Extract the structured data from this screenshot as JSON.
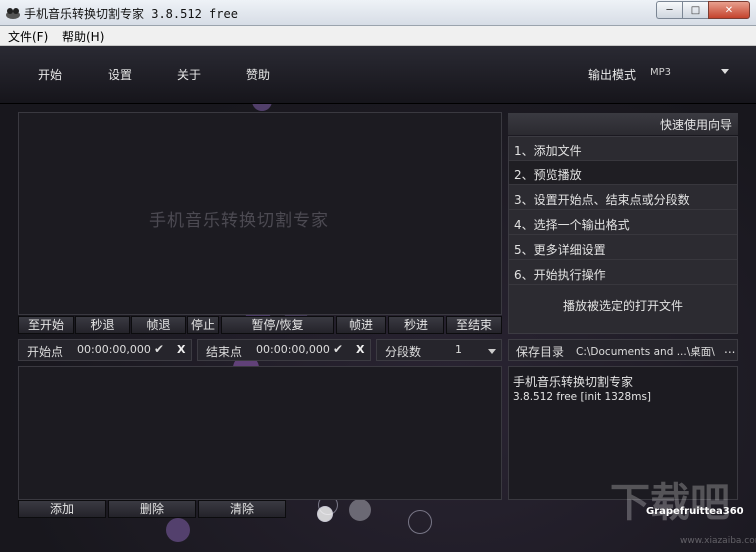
{
  "window": {
    "title": "手机音乐转换切割专家 3.8.512 free",
    "controls": {
      "minimize": "─",
      "maximize": "□",
      "close": "✕"
    }
  },
  "menu": [
    "文件(F)",
    "帮助(H)"
  ],
  "nav": {
    "items": [
      "开始",
      "设置",
      "关于",
      "赞助"
    ],
    "output_mode_label": "输出模式",
    "output_mode_value": "MP3"
  },
  "preview": {
    "title_text": "手机音乐转换切割专家"
  },
  "transport": [
    "至开始",
    "秒退",
    "帧退",
    "停止",
    "暂停/恢复",
    "帧进",
    "秒进",
    "至结束"
  ],
  "start_point": {
    "label": "开始点",
    "value": "00:00:00,000",
    "confirm": "✔",
    "clear": "X"
  },
  "end_point": {
    "label": "结束点",
    "value": "00:00:00,000",
    "confirm": "✔",
    "clear": "X"
  },
  "segments": {
    "label": "分段数",
    "value": "1"
  },
  "playlist_buttons": [
    "添加",
    "删除",
    "清除"
  ],
  "guide": {
    "header": "快速使用向导",
    "steps": [
      "1、添加文件",
      "2、预览播放",
      "3、设置开始点、结束点或分段数",
      "4、选择一个输出格式",
      "5、更多详细设置",
      "6、开始执行操作"
    ],
    "active_index": 1,
    "play_selected": "播放被选定的打开文件"
  },
  "save": {
    "label": "保存目录",
    "path": "C:\\Documents and ...\\桌面\\",
    "browse": "..."
  },
  "info": {
    "line1": "手机音乐转换切割专家",
    "line2": "3.8.512 free [init 1328ms]"
  },
  "watermark": "Grapefruittea360",
  "site_logo": {
    "text": "下载吧",
    "url": "www.xiazaiba.com"
  }
}
